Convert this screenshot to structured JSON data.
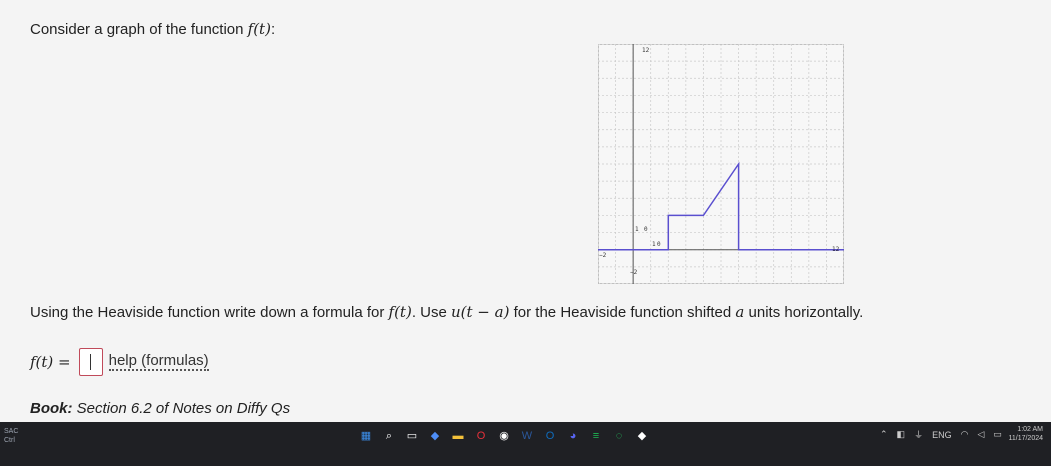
{
  "question": {
    "prefix": "Consider a graph of the function ",
    "func": "f(t)",
    "suffix": ":"
  },
  "graph": {
    "y_top_label": "12",
    "y_mid_label": "1",
    "y_bottom_label": "−2",
    "x_left_label": "−2",
    "x_right_label": "12",
    "x_mid_label": "1",
    "origin_label_a": "0",
    "origin_label_b": "0"
  },
  "chart_data": {
    "type": "line",
    "xlim": [
      -2,
      12
    ],
    "ylim": [
      -2,
      12
    ],
    "grid": true,
    "x": [
      -2,
      2,
      2,
      4,
      6,
      6,
      12
    ],
    "y": [
      0,
      0,
      2,
      2,
      5,
      0,
      0
    ],
    "color": "#5a4fcf"
  },
  "instruction": {
    "prefix": "Using the Heaviside function write down a formula for ",
    "func": "f(t)",
    "middle": ". Use ",
    "heaviside": "u(t − a)",
    "suffix": " for the Heaviside function shifted ",
    "a": "a",
    "end": " units horizontally."
  },
  "answer": {
    "lhs": "f(t) =",
    "help_label": "help (formulas)"
  },
  "book": {
    "label": "Book:",
    "text": " Section 6.2 of Notes on Diffy Qs"
  },
  "taskbar": {
    "left_line1": "SAC",
    "left_line2": "Ctrl",
    "lang": "ENG",
    "time": "1:02 AM",
    "date": "11/17/2024",
    "icons": [
      "windows-icon",
      "search-icon",
      "task-view-icon",
      "copilot-icon",
      "file-explorer-icon",
      "opera-icon",
      "chrome-icon",
      "word-icon",
      "outlook-icon",
      "discord-icon",
      "spotify-icon",
      "whatsapp-icon",
      "tidal-icon"
    ],
    "icon_colors": [
      "#3b8eea",
      "#ffffff",
      "#ffffff",
      "#4e8ef7",
      "#f3c13a",
      "#e8303a",
      "#ffffff",
      "#2b579a",
      "#0f6cbd",
      "#5865f2",
      "#1db954",
      "#25d366",
      "#ffffff"
    ],
    "icon_glyphs": [
      "▦",
      "⌕",
      "▭",
      "◆",
      "▬",
      "O",
      "◉",
      "W",
      "O",
      "◕",
      "≡",
      "◌",
      "◆"
    ]
  }
}
